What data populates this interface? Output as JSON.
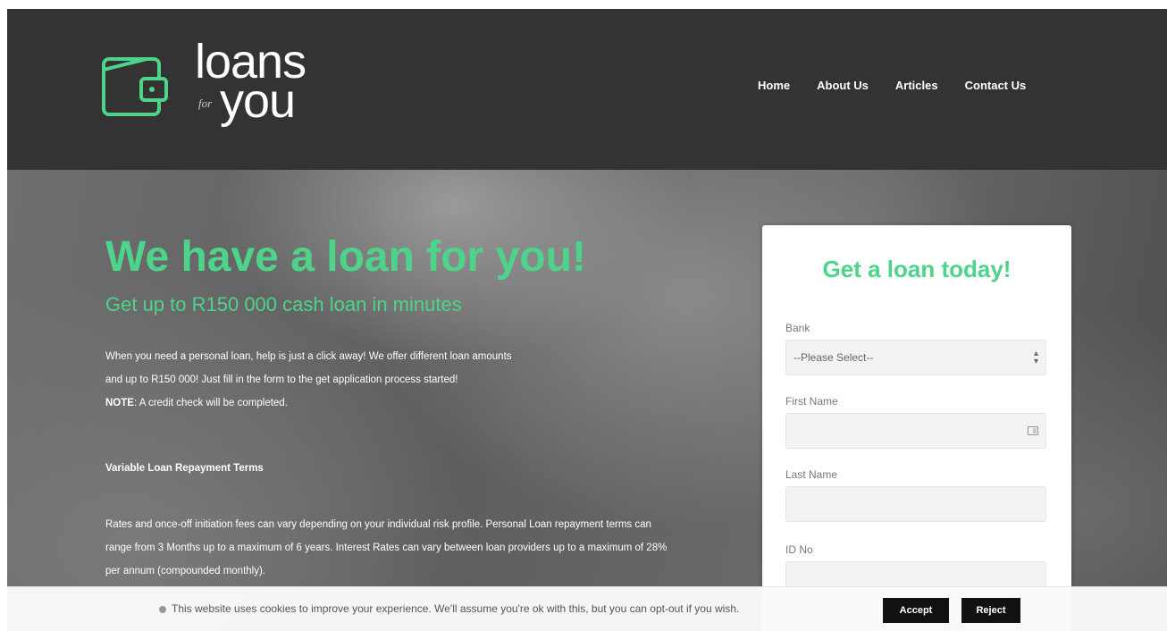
{
  "brand": {
    "logo_main": "loans",
    "logo_for": "for",
    "logo_you": "you",
    "accent_color": "#4ed48a"
  },
  "nav": {
    "items": [
      {
        "label": "Home"
      },
      {
        "label": "About Us"
      },
      {
        "label": "Articles"
      },
      {
        "label": "Contact Us"
      }
    ]
  },
  "hero": {
    "title": "We have a loan for you!",
    "subtitle": "Get up to R150 000 cash loan in minutes",
    "intro_line1": "When you need a personal loan, help is just a click away! We offer different loan amounts",
    "intro_line2": "and up to R150 000! Just fill in the form to the get application process started!",
    "note_label": "NOTE",
    "note_text": ": A credit check will be completed.",
    "section_heading": "Variable Loan Repayment Terms",
    "section_body": "Rates and once-off initiation fees can vary depending on your individual risk profile. Personal Loan repayment terms can range from 3 Months up to a maximum of 6 years. Interest Rates can vary between loan providers up to a maximum of 28% per annum (compounded monthly)."
  },
  "form": {
    "title": "Get a loan today!",
    "bank_label": "Bank",
    "bank_value": "--Please Select--",
    "first_name_label": "First Name",
    "last_name_label": "Last Name",
    "id_label": "ID No"
  },
  "cookie": {
    "text": "This website uses cookies to improve your experience. We'll assume you're ok with this, but you can opt-out if you wish.",
    "accept_label": "Accept",
    "reject_label": "Reject"
  }
}
